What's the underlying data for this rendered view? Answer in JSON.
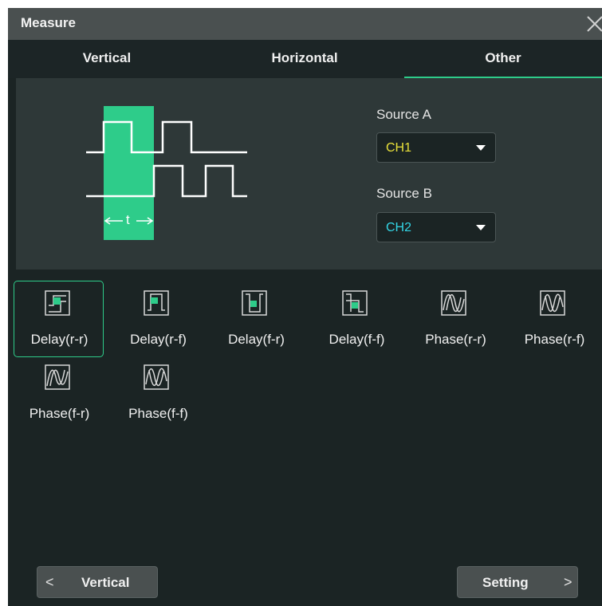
{
  "window": {
    "title": "Measure"
  },
  "tabs": [
    {
      "label": "Vertical"
    },
    {
      "label": "Horizontal"
    },
    {
      "label": "Other"
    }
  ],
  "active_tab": "Other",
  "diagram": {
    "time_label": "t"
  },
  "sources": {
    "a": {
      "label": "Source A",
      "value": "CH1",
      "color": "#e8e03a"
    },
    "b": {
      "label": "Source B",
      "value": "CH2",
      "color": "#33d6e6"
    }
  },
  "measurements": [
    {
      "label": "Delay(r-r)",
      "icon": "delay-rise-rise-icon"
    },
    {
      "label": "Delay(r-f)",
      "icon": "delay-rise-fall-icon"
    },
    {
      "label": "Delay(f-r)",
      "icon": "delay-fall-rise-icon"
    },
    {
      "label": "Delay(f-f)",
      "icon": "delay-fall-fall-icon"
    },
    {
      "label": "Phase(r-r)",
      "icon": "phase-rise-rise-icon"
    },
    {
      "label": "Phase(r-f)",
      "icon": "phase-rise-fall-icon"
    },
    {
      "label": "Phase(f-r)",
      "icon": "phase-fall-rise-icon"
    },
    {
      "label": "Phase(f-f)",
      "icon": "phase-fall-fall-icon"
    }
  ],
  "selected_measurement": "Delay(r-r)",
  "footer": {
    "back_label": "Vertical",
    "next_label": "Setting",
    "back_chevron": "<",
    "next_chevron": ">"
  },
  "colors": {
    "accent": "#2ecc8a",
    "panel": "#2e3838",
    "background": "#1b2424"
  }
}
